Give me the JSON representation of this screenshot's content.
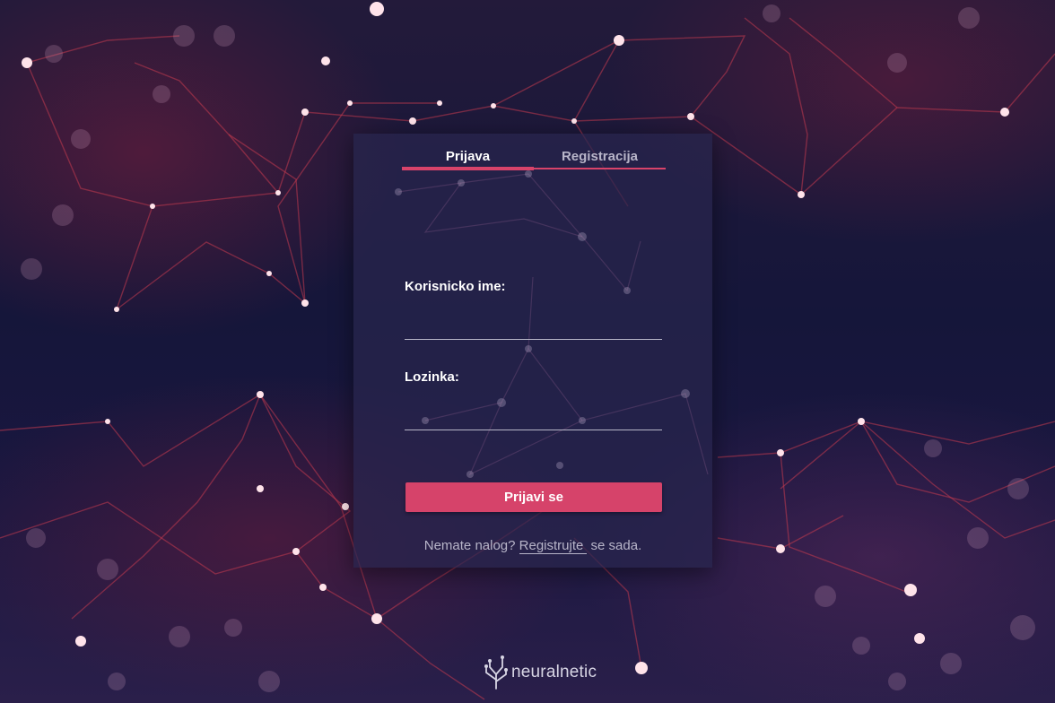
{
  "tabs": [
    {
      "label": "Prijava",
      "active": true
    },
    {
      "label": "Registracija",
      "active": false
    }
  ],
  "form": {
    "username_label": "Korisnicko ime:",
    "username_value": "",
    "password_label": "Lozinka:",
    "password_value": "",
    "submit_label": "Prijavi se"
  },
  "footer": {
    "prefix": "Nemate nalog? ",
    "link": "Registrujte",
    "suffix": " se sada."
  },
  "logo": {
    "text": "neuralnetic",
    "icon": "neural-branch-icon"
  },
  "colors": {
    "accent": "#d6436a",
    "card": "#28264e",
    "text_muted": "#b8b5c9"
  }
}
